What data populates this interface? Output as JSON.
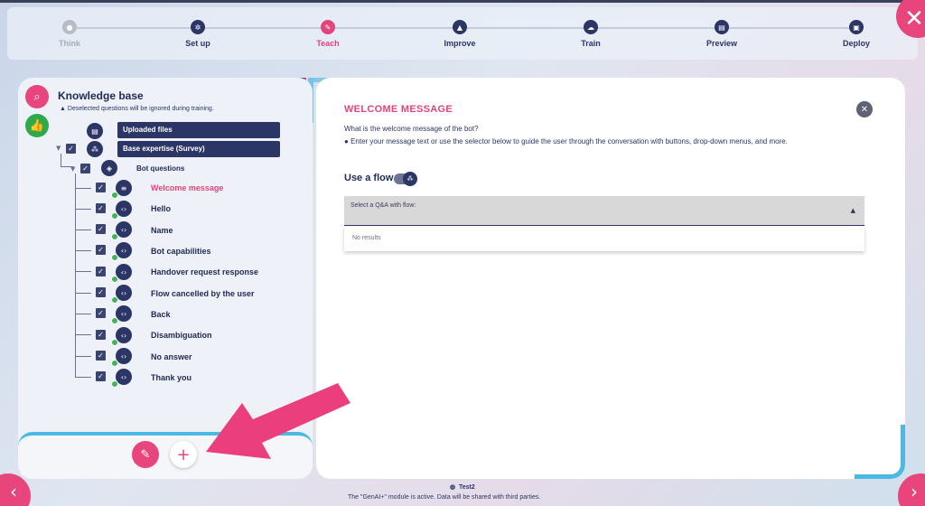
{
  "stepper": {
    "steps": [
      {
        "label": "Think",
        "icon": "bulb-icon",
        "state": "done"
      },
      {
        "label": "Set up",
        "icon": "gear-icon",
        "state": "normal"
      },
      {
        "label": "Teach",
        "icon": "pencil-icon",
        "state": "active"
      },
      {
        "label": "Improve",
        "icon": "rocket-icon",
        "state": "normal"
      },
      {
        "label": "Train",
        "icon": "cloud-icon",
        "state": "normal"
      },
      {
        "label": "Preview",
        "icon": "window-icon",
        "state": "normal"
      },
      {
        "label": "Deploy",
        "icon": "deploy-icon",
        "state": "normal"
      }
    ]
  },
  "sidebar": {
    "title": "Knowledge base",
    "note": "Deselected questions will be ignored during training.",
    "uploaded_files": "Uploaded files",
    "base_expertise": "Base expertise (Survey)",
    "bot_questions": "Bot questions",
    "items": [
      {
        "label": "Welcome message",
        "active": true
      },
      {
        "label": "Hello"
      },
      {
        "label": "Name"
      },
      {
        "label": "Bot capabilities"
      },
      {
        "label": "Handover request response"
      },
      {
        "label": "Flow cancelled by the user"
      },
      {
        "label": "Back"
      },
      {
        "label": "Disambiguation"
      },
      {
        "label": "No answer"
      },
      {
        "label": "Thank you"
      }
    ]
  },
  "main": {
    "title": "WELCOME MESSAGE",
    "question": "What is the welcome message of the bot?",
    "info": "Enter your message text or use the selector below to guide the user through the conversation with buttons, drop-down menus, and more.",
    "use_flow_label": "Use a flow",
    "select_label": "Select a Q&A with flow:",
    "no_results": "No results"
  },
  "footer": {
    "bot_name": "Test2",
    "notice": "The \"GenAI+\" module is active. Data will be shared with third parties."
  },
  "colors": {
    "accent": "#e2457b",
    "navy": "#2b3566",
    "green": "#2faa4a",
    "cyan": "#4cb8e4"
  }
}
